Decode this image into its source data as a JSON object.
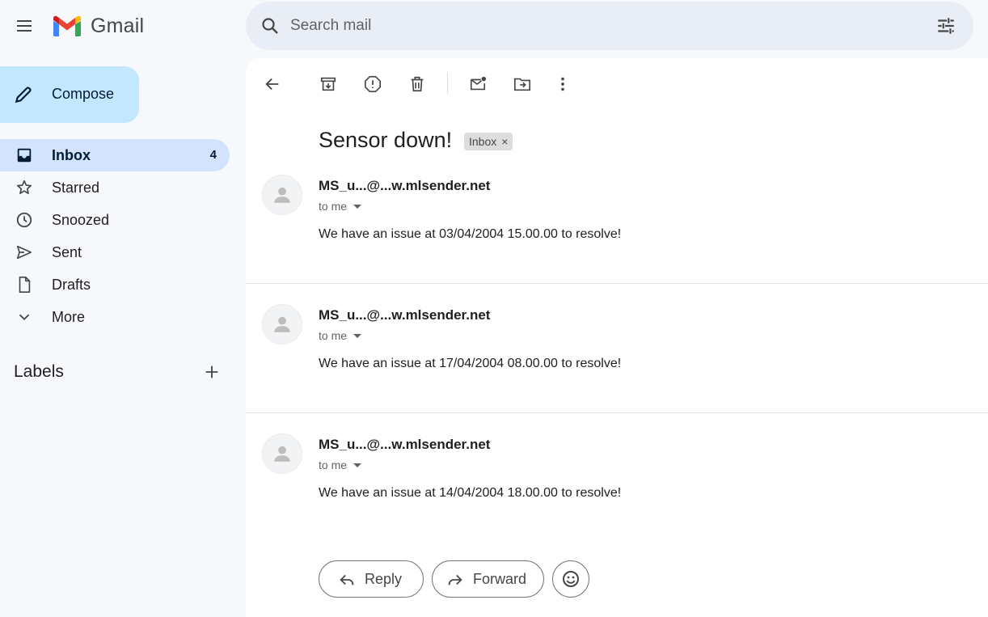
{
  "app": {
    "name": "Gmail"
  },
  "search": {
    "placeholder": "Search mail"
  },
  "sidebar": {
    "compose_label": "Compose",
    "items": [
      {
        "label": "Inbox",
        "count": "4",
        "icon": "inbox-icon",
        "active": true
      },
      {
        "label": "Starred",
        "icon": "star-icon"
      },
      {
        "label": "Snoozed",
        "icon": "clock-icon"
      },
      {
        "label": "Sent",
        "icon": "send-icon"
      },
      {
        "label": "Drafts",
        "icon": "draft-icon"
      },
      {
        "label": "More",
        "icon": "chevron-down-icon"
      }
    ],
    "labels_heading": "Labels"
  },
  "toolbar": {
    "icons": [
      "back-arrow-icon",
      "archive-icon",
      "report-spam-icon",
      "delete-icon",
      "mark-unread-icon",
      "move-to-icon",
      "more-vert-icon"
    ]
  },
  "thread": {
    "subject": "Sensor down!",
    "label_chip": "Inbox",
    "label_chip_close": "×",
    "messages": [
      {
        "sender": "MS_u...@...w.mlsender.net",
        "recipient": "to me",
        "body": "We have an issue at 03/04/2004 15.00.00 to resolve!"
      },
      {
        "sender": "MS_u...@...w.mlsender.net",
        "recipient": "to me",
        "body": "We have an issue at 17/04/2004 08.00.00 to resolve!"
      },
      {
        "sender": "MS_u...@...w.mlsender.net",
        "recipient": "to me",
        "body": "We have an issue at 14/04/2004 18.00.00 to resolve!"
      }
    ]
  },
  "actions": {
    "reply_label": "Reply",
    "forward_label": "Forward"
  },
  "colors": {
    "compose_bg": "#c2e7ff",
    "active_nav_bg": "#d3e3fd",
    "search_bg": "#e9eef6",
    "page_bg": "#f6f8fc"
  }
}
